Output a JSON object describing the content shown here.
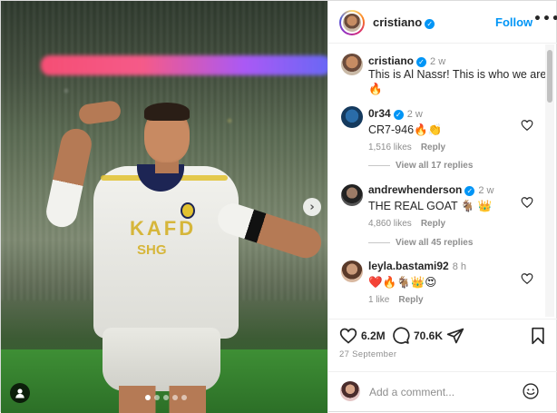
{
  "post": {
    "username": "cristiano",
    "follow_label": "Follow",
    "more_label": "•••",
    "caption_user": "cristiano",
    "caption_time": "2 w",
    "caption_text": "This is Al Nassr! This is who we are! 🔥",
    "likes_count": "6.2M",
    "comments_count": "70.6K",
    "date": "27 September"
  },
  "comments": [
    {
      "user": "0r34",
      "time": "2 w",
      "text": "CR7-946🔥👏",
      "likes": "1,516 likes",
      "reply": "Reply",
      "view_replies": "View all 17 replies"
    },
    {
      "user": "andrewhenderson",
      "time": "2 w",
      "text": "THE REAL GOAT 🐐 👑",
      "likes": "4,860 likes",
      "reply": "Reply",
      "view_replies": "View all 45 replies"
    },
    {
      "user": "leyla.bastami92",
      "time": "8 h",
      "text": "❤️🔥🐐👑😍",
      "likes": "1 like",
      "reply": "Reply"
    }
  ],
  "media_text": {
    "sponsor_top": "KAFD",
    "sponsor_bottom": "SHG"
  },
  "add_comment": {
    "placeholder": "Add a comment..."
  },
  "icons": {
    "verified": "✓",
    "next": "›"
  },
  "colors": {
    "link": "#0095f6",
    "verified": "#0095f6",
    "muted": "#8e8e8e"
  }
}
